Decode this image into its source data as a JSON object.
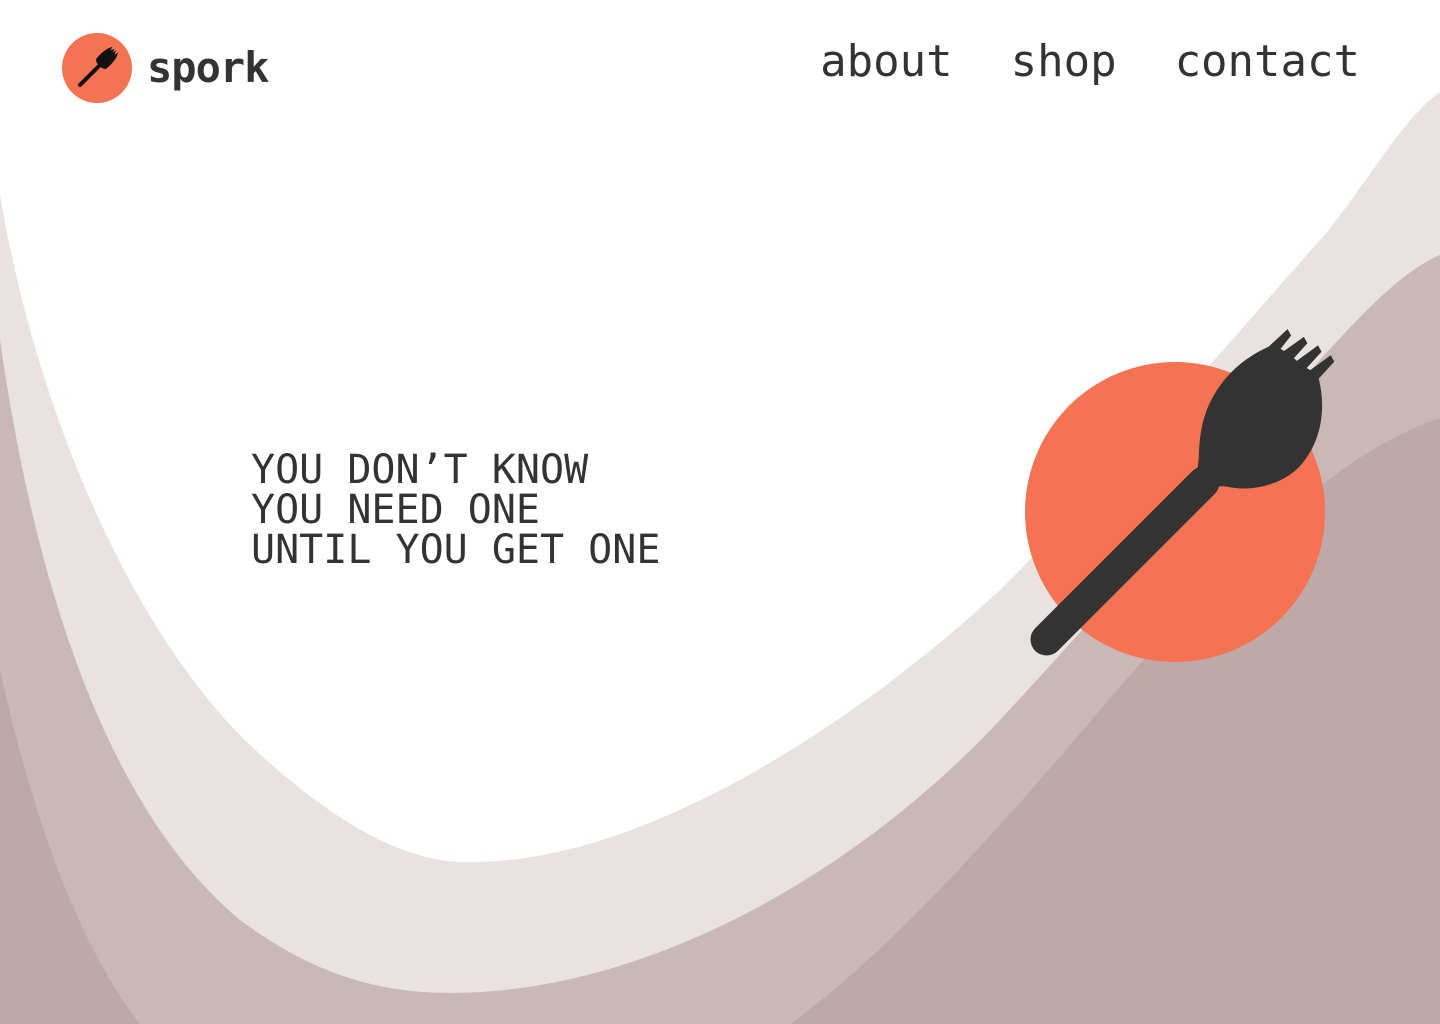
{
  "brand": {
    "name": "spork",
    "logo_icon": "spork-icon"
  },
  "nav": {
    "items": [
      {
        "label": "about"
      },
      {
        "label": "shop"
      },
      {
        "label": "contact"
      }
    ]
  },
  "hero": {
    "tagline_lines": [
      "YOU DON’T KNOW",
      "YOU NEED ONE",
      "UNTIL YOU GET ONE"
    ],
    "illustration_icon": "spork-icon"
  },
  "colors": {
    "accent": "#f47352",
    "ink": "#333333",
    "background": "#ffffff",
    "wave_light": "#e8e2e0",
    "wave_mid": "#c9b8b5",
    "wave_dark": "#bea9a8"
  }
}
